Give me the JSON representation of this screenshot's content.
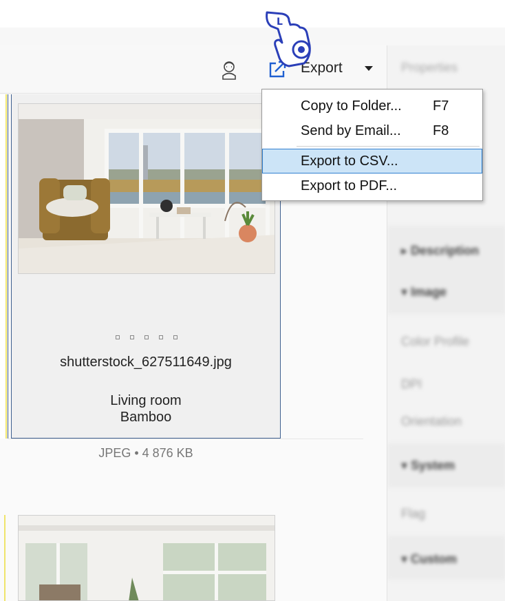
{
  "toolbar": {
    "user_icon": "user-icon",
    "export_icon": "external-export-icon",
    "export_label": "Export"
  },
  "export_menu": {
    "items": [
      {
        "label": "Copy to Folder...",
        "shortcut": "F7",
        "highlighted": false
      },
      {
        "label": "Send by Email...",
        "shortcut": "F8",
        "highlighted": false
      },
      {
        "label": "Export to CSV...",
        "shortcut": "",
        "highlighted": true
      },
      {
        "label": "Export to PDF...",
        "shortcut": "",
        "highlighted": false
      }
    ]
  },
  "selected_item": {
    "filename": "shutterstock_627511649.jpg",
    "caption_line1": "Living room",
    "caption_line2": "Bamboo",
    "meta": "JPEG • 4 876 KB",
    "rating_slots": 5
  },
  "properties_panel": {
    "header": "Properties",
    "rows": [
      "Description",
      "Image",
      "Color Profile",
      "DPI",
      "Orientation",
      "System",
      "Flag",
      "Custom"
    ]
  },
  "colors": {
    "selection_border": "#3e5f8f",
    "menu_highlight": "#cce4f7",
    "menu_highlight_border": "#2e7fd0",
    "cursor_blue": "#2b3fb8"
  }
}
